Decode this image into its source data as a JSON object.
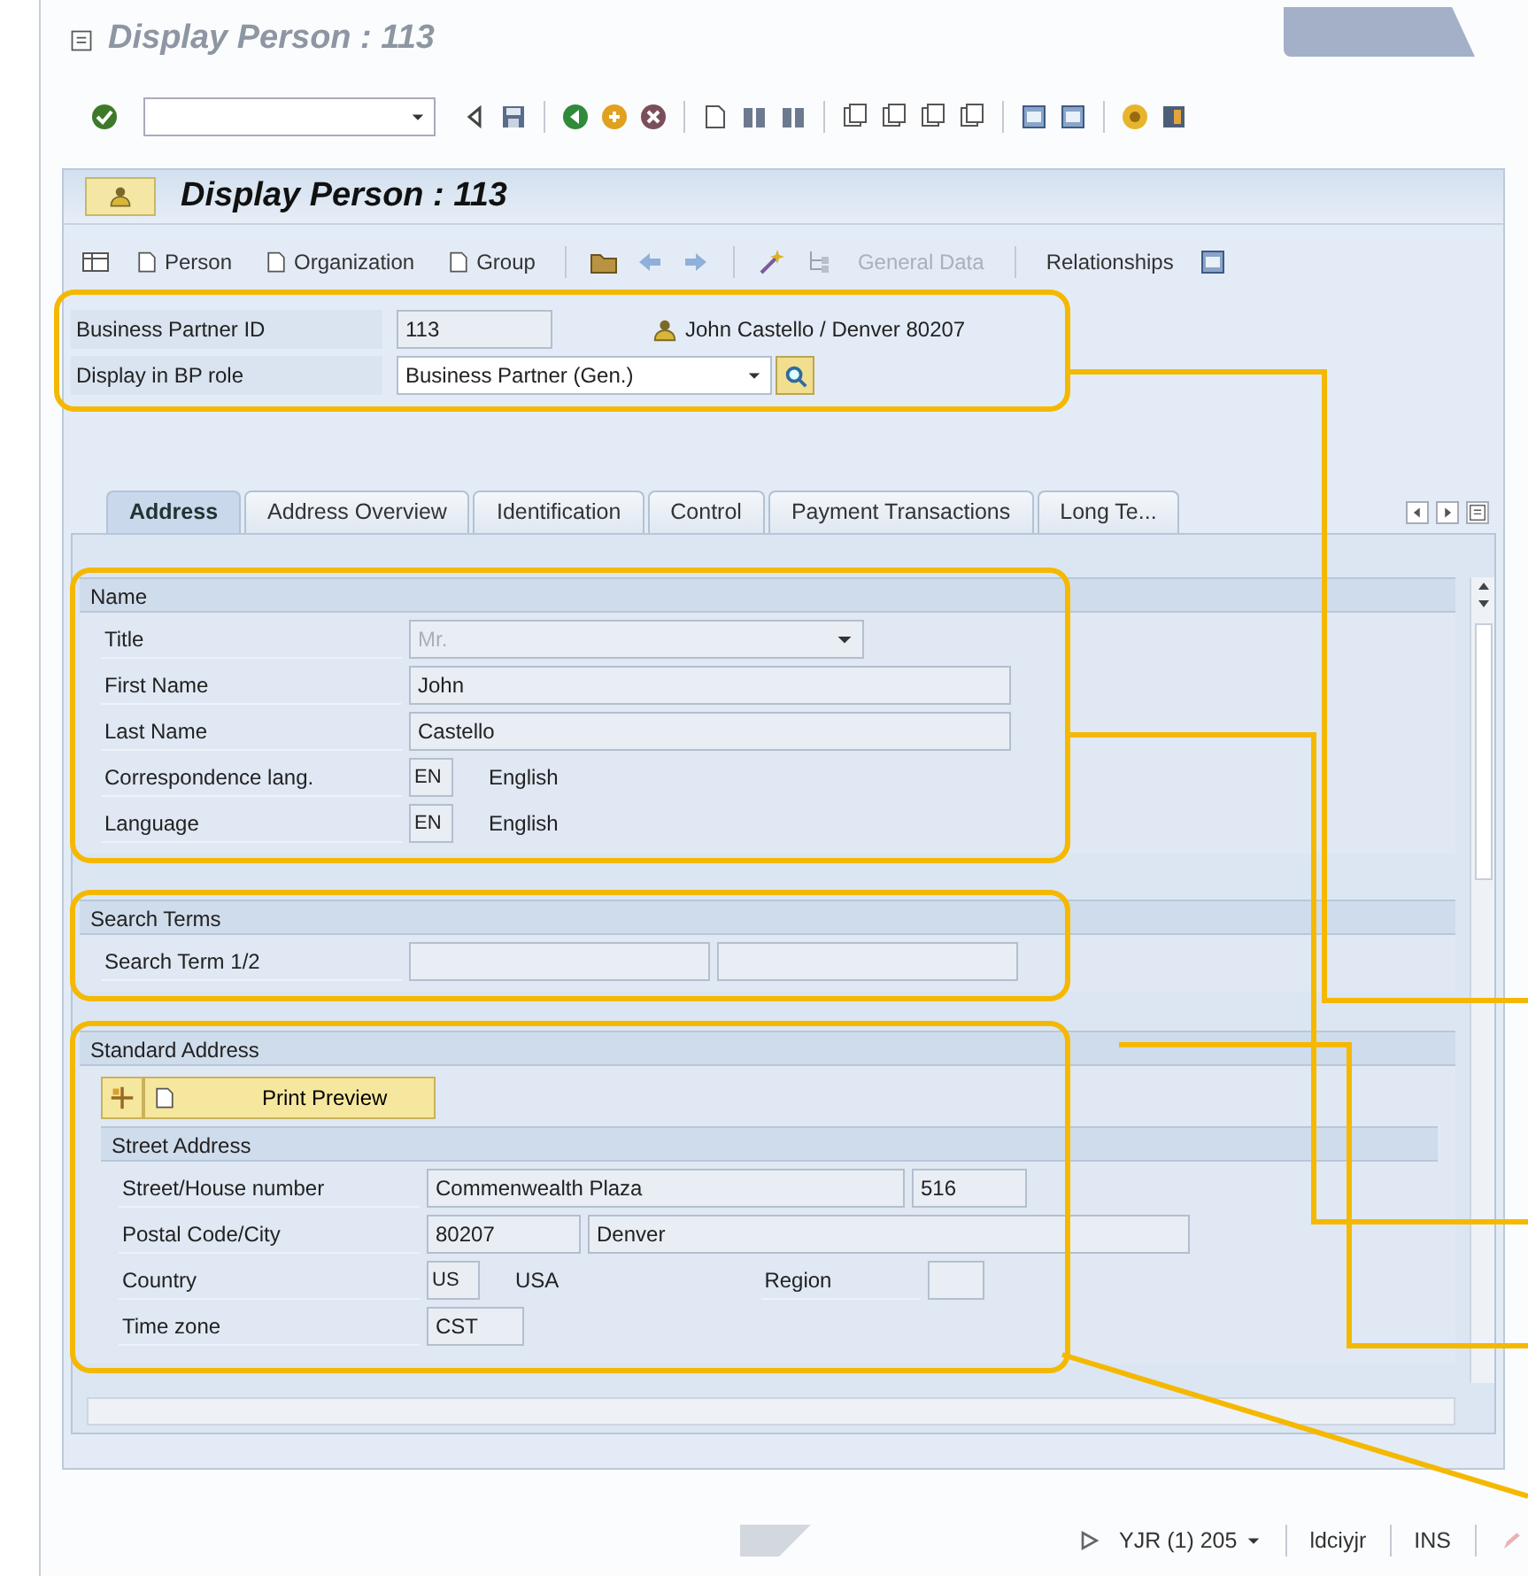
{
  "window": {
    "title": "Display Person : 113"
  },
  "screen_title": "Display Person : 113",
  "app_toolbar": [
    {
      "label": "Person",
      "disabled": false
    },
    {
      "label": "Organization",
      "disabled": false
    },
    {
      "label": "Group",
      "disabled": false
    },
    {
      "label": "General Data",
      "disabled": true
    },
    {
      "label": "Relationships",
      "disabled": false
    }
  ],
  "header": {
    "rows": [
      {
        "label": "Business Partner ID",
        "kind": "id",
        "value": "113",
        "description": "John Castello / Denver 80207"
      },
      {
        "label": "Display in BP role",
        "kind": "role",
        "value": "Business Partner (Gen.)"
      }
    ]
  },
  "tabs": [
    {
      "label": "Address",
      "selected": true
    },
    {
      "label": "Address Overview",
      "selected": false
    },
    {
      "label": "Identification",
      "selected": false
    },
    {
      "label": "Control",
      "selected": false
    },
    {
      "label": "Payment Transactions",
      "selected": false
    },
    {
      "label": "Long Te...",
      "selected": false
    }
  ],
  "groups": [
    {
      "title": "Name",
      "rows": [
        {
          "label": "Title",
          "fields": [
            {
              "kind": "dropdown",
              "value": "Mr.",
              "disabled": true
            }
          ]
        },
        {
          "label": "First Name",
          "fields": [
            {
              "kind": "long",
              "value": "John"
            }
          ]
        },
        {
          "label": "Last Name",
          "fields": [
            {
              "kind": "long",
              "value": "Castello"
            }
          ]
        },
        {
          "label": "Correspondence lang.",
          "fields": [
            {
              "kind": "code",
              "value": "EN"
            },
            {
              "kind": "desc",
              "value": "English"
            }
          ]
        },
        {
          "label": "Language",
          "fields": [
            {
              "kind": "code",
              "value": "EN"
            },
            {
              "kind": "desc",
              "value": "English"
            }
          ]
        }
      ]
    },
    {
      "title": "Search Terms",
      "rows": [
        {
          "label": "Search Term 1/2",
          "fields": [
            {
              "kind": "search"
            },
            {
              "kind": "search"
            }
          ]
        }
      ]
    },
    {
      "title": "Standard Address",
      "buttons": [
        {
          "label": "Print Preview"
        }
      ],
      "subtitle": "Street Address",
      "rows": [
        {
          "label": "Street/House number",
          "fields": [
            {
              "kind": "street",
              "value": "Commenwealth Plaza"
            },
            {
              "kind": "house",
              "value": "516"
            }
          ]
        },
        {
          "label": "Postal Code/City",
          "fields": [
            {
              "kind": "postal",
              "value": "80207"
            },
            {
              "kind": "city",
              "value": "Denver"
            }
          ]
        },
        {
          "label": "Country",
          "fields": [
            {
              "kind": "country",
              "value": "US"
            },
            {
              "kind": "desc",
              "value": "USA"
            },
            {
              "kind": "label",
              "value": "Region"
            },
            {
              "kind": "region"
            }
          ]
        },
        {
          "label": "Time zone",
          "fields": [
            {
              "kind": "tz",
              "value": "CST"
            }
          ]
        }
      ]
    }
  ],
  "status_bar": {
    "system": "YJR (1) 205",
    "server": "ldciyjr",
    "mode": "INS"
  }
}
